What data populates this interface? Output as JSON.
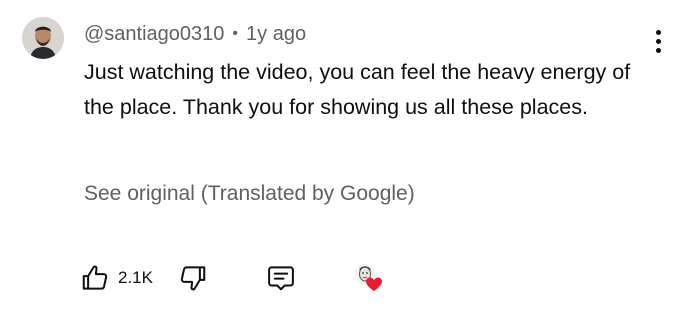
{
  "comment": {
    "author": "@santiago0310",
    "separator": "•",
    "time": "1y ago",
    "text": "Just watching the video, you can feel the heavy energy of the place. Thank you for showing us all these places.",
    "translation_link": "See original (Translated by Google)"
  },
  "actions": {
    "like_count": "2.1K",
    "like_icon": "thumbs-up-icon",
    "dislike_icon": "thumbs-down-icon",
    "reply_icon": "comment-icon",
    "creator_heart_icon": "creator-heart-icon"
  },
  "colors": {
    "text": "#0f0f0f",
    "secondary": "#606060",
    "heart": "#e41e31"
  }
}
